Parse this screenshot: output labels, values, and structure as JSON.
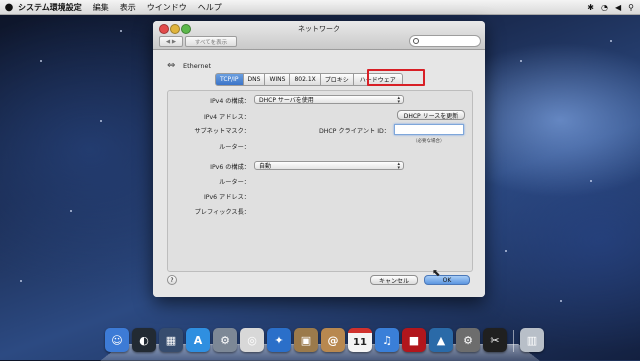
{
  "menubar": {
    "app_name": "システム環境設定",
    "items": [
      "編集",
      "表示",
      "ウインドウ",
      "ヘルプ"
    ]
  },
  "window": {
    "title": "ネットワーク",
    "toolbar": {
      "back_label": "◀ ▶",
      "show_all_label": "すべてを表示"
    }
  },
  "interface": {
    "name": "Ethernet"
  },
  "tabs": [
    {
      "label": "TCP/IP",
      "selected": true
    },
    {
      "label": "DNS",
      "selected": false
    },
    {
      "label": "WINS",
      "selected": false
    },
    {
      "label": "802.1X",
      "selected": false
    },
    {
      "label": "プロキシ",
      "selected": false
    },
    {
      "label": "ハードウェア",
      "selected": false,
      "highlighted": true
    }
  ],
  "ipv4": {
    "configure_label": "IPv4 の構成：",
    "configure_value": "DHCP サーバを使用",
    "address_label": "IPv4 アドレス：",
    "subnet_label": "サブネットマスク：",
    "router_label": "ルーター：",
    "renew_button": "DHCP リースを更新",
    "client_id_label": "DHCP クライアント ID：",
    "client_id_value": "",
    "client_id_hint": "（必要な場合）"
  },
  "ipv6": {
    "configure_label": "IPv6 の構成：",
    "configure_value": "自動",
    "router_label": "ルーター：",
    "address_label": "IPv6 アドレス：",
    "prefix_label": "プレフィックス長："
  },
  "footer": {
    "help_label": "?",
    "cancel_label": "キャンセル",
    "ok_label": "OK"
  },
  "dock": {
    "calendar_day": "11",
    "icons": [
      {
        "name": "finder-icon",
        "color": "#3d7bd6",
        "glyph": "☺"
      },
      {
        "name": "dashboard-icon",
        "color": "#222a33",
        "glyph": "◐"
      },
      {
        "name": "mission-control-icon",
        "color": "#364c6e",
        "glyph": "▦"
      },
      {
        "name": "app-store-icon",
        "color": "#2f8fe0",
        "glyph": "A"
      },
      {
        "name": "system-preferences-dock-icon",
        "color": "#7d8896",
        "glyph": "⚙"
      },
      {
        "name": "chrome-icon",
        "color": "#d8d8d8",
        "glyph": "◎"
      },
      {
        "name": "safari-icon",
        "color": "#2b6fc9",
        "glyph": "✦"
      },
      {
        "name": "preview-icon",
        "color": "#9b7a4b",
        "glyph": "▣"
      },
      {
        "name": "address-book-icon",
        "color": "#b8884f",
        "glyph": "@"
      },
      {
        "name": "calendar-icon",
        "color": "#f4f4f4",
        "glyph": ""
      },
      {
        "name": "itunes-icon",
        "color": "#3a7fd8",
        "glyph": "♫"
      },
      {
        "name": "photo-booth-icon",
        "color": "#b2161c",
        "glyph": "■"
      },
      {
        "name": "iphoto-icon",
        "color": "#2a6aa8",
        "glyph": "▲"
      },
      {
        "name": "utility-icon",
        "color": "#6d6d6d",
        "glyph": "⚙"
      },
      {
        "name": "final-cut-icon",
        "color": "#202020",
        "glyph": "✂"
      },
      {
        "name": "trash-icon",
        "color": "#b8bfc8",
        "glyph": "▥"
      }
    ]
  }
}
